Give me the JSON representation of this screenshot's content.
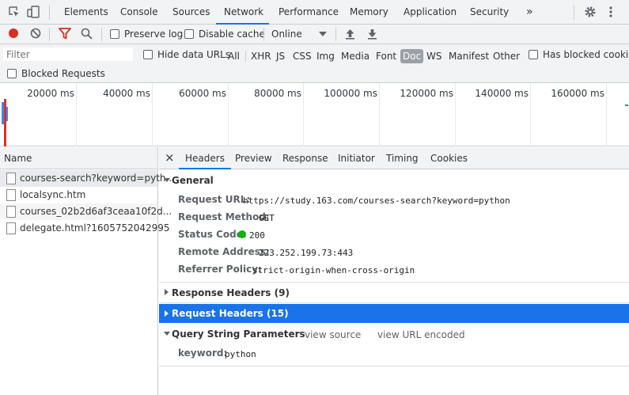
{
  "tabs": [
    "Elements",
    "Console",
    "Sources",
    "Network",
    "Performance",
    "Memory",
    "Application",
    "Security"
  ],
  "more_tabs": "»",
  "toolbar": {
    "preserve_log": "Preserve log",
    "disable_cache": "Disable cache",
    "throttling": "Online"
  },
  "filter": {
    "placeholder": "Filter",
    "hide_data_urls": "Hide data URLs",
    "types": [
      "All",
      "XHR",
      "JS",
      "CSS",
      "Img",
      "Media",
      "Font",
      "Doc",
      "WS",
      "Manifest",
      "Other"
    ],
    "selected_type": "Doc",
    "has_blocked_cookies": "Has blocked cookies",
    "blocked_requests": "Blocked Requests"
  },
  "overview": {
    "ticks": [
      "20000 ms",
      "40000 ms",
      "60000 ms",
      "80000 ms",
      "100000 ms",
      "120000 ms",
      "140000 ms",
      "160000 ms"
    ]
  },
  "requests": {
    "header": "Name",
    "items": [
      "courses-search?keyword=pyth...",
      "localsync.htm",
      "courses_02b2d6af3ceaa10f2d...",
      "delegate.html?1605752042995"
    ]
  },
  "details": {
    "close": "×",
    "tabs": [
      "Headers",
      "Preview",
      "Response",
      "Initiator",
      "Timing",
      "Cookies"
    ],
    "general": {
      "title": "General",
      "request_url_label": "Request URL:",
      "request_url": "https://study.163.com/courses-search?keyword=python",
      "method_label": "Request Method:",
      "method": "GET",
      "status_label": "Status Code:",
      "status": "200",
      "remote_label": "Remote Address:",
      "remote": "223.252.199.73:443",
      "referrer_label": "Referrer Policy:",
      "referrer": "strict-origin-when-cross-origin"
    },
    "response_headers": "Response Headers (9)",
    "request_headers": "Request Headers (15)",
    "query": {
      "title": "Query String Parameters",
      "view_source": "view source",
      "view_url_encoded": "view URL encoded",
      "param_label": "keyword:",
      "param_value": "python"
    }
  },
  "colors": {
    "accent": "#1a73e8",
    "selected_row": "#1a73e8",
    "record": "#d93025",
    "status_ok": "#0bb40b"
  }
}
